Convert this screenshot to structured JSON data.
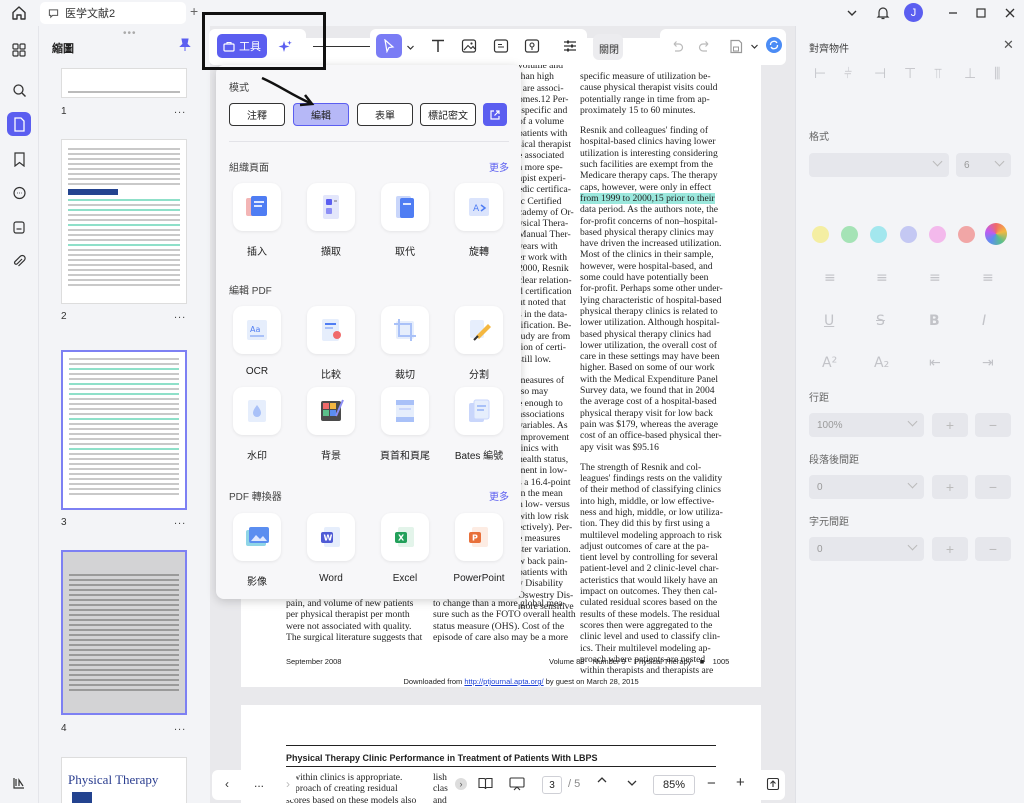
{
  "app": {
    "tab_title": "医学文献2",
    "avatar_initial": "J"
  },
  "thumbnails": {
    "title": "縮圖",
    "pages": [
      {
        "number": "1",
        "more": "..."
      },
      {
        "number": "2",
        "more": "..."
      },
      {
        "number": "3",
        "more": "..."
      },
      {
        "number": "4",
        "more": "..."
      }
    ],
    "page5_heading_1": "Physical",
    "page5_heading_2": "Therapy"
  },
  "toolbar": {
    "tools_label": "工具",
    "close_label": "關閉"
  },
  "tools_panel": {
    "mode_title": "模式",
    "modes": [
      {
        "label": "注釋"
      },
      {
        "label": "編輯"
      },
      {
        "label": "表單"
      },
      {
        "label": "標記密文"
      }
    ],
    "organize_title": "組織頁面",
    "organize_more": "更多",
    "organize_items": [
      {
        "label": "插入",
        "icon": "insert-pages-icon"
      },
      {
        "label": "擷取",
        "icon": "extract-pages-icon"
      },
      {
        "label": "取代",
        "icon": "replace-pages-icon"
      },
      {
        "label": "旋轉",
        "icon": "rotate-pages-icon"
      }
    ],
    "edit_title": "編輯 PDF",
    "edit_items": [
      {
        "label": "OCR",
        "icon": "ocr-icon"
      },
      {
        "label": "比較",
        "icon": "compare-icon"
      },
      {
        "label": "裁切",
        "icon": "crop-icon"
      },
      {
        "label": "分割",
        "icon": "split-icon"
      },
      {
        "label": "水印",
        "icon": "watermark-icon"
      },
      {
        "label": "背景",
        "icon": "background-icon"
      },
      {
        "label": "頁首和頁尾",
        "icon": "header-footer-icon"
      },
      {
        "label": "Bates 編號",
        "icon": "bates-number-icon"
      }
    ],
    "convert_title": "PDF 轉換器",
    "convert_more": "更多",
    "convert_items": [
      {
        "label": "影像",
        "icon": "image-icon"
      },
      {
        "label": "Word",
        "icon": "word-icon"
      },
      {
        "label": "Excel",
        "icon": "excel-icon"
      },
      {
        "label": "PowerPoint",
        "icon": "powerpoint-icon"
      }
    ]
  },
  "document": {
    "col_left_peek": [
      "volume and",
      "than high",
      ", are associ-",
      "omes.12 Per-",
      "-specific and",
      "of a volume",
      "patients with",
      "sical therapist",
      "e associated",
      "a more spe-",
      "apist experi-",
      "edic certifica-",
      "ic Certified",
      "cademy of Or-",
      "ysical Thera-",
      "Manual Ther-",
      "years with",
      "er work with",
      "2000, Resnik",
      "clear relation-",
      "d certification",
      "ut noted that",
      "s in the data-",
      "tification. Be-",
      "tudy are from",
      "tion of certi-",
      "still low."
    ],
    "col_left_peek_2": [
      "measures of",
      "lso may",
      "e enough to",
      "associations",
      "variables. As",
      "improvement",
      "linics with",
      "health status,",
      "ment in low-",
      "s a 16.4-point",
      "in the mean",
      "n low- versus",
      "with low risk",
      "ectively). Per-",
      "e measures",
      "ster variation.",
      "w back pain-",
      "patients with",
      "y Disability",
      "Oswestry Dis-",
      "more sensitive"
    ],
    "right_para_1": [
      "specific measure of utilization be-",
      "cause physical therapist visits could",
      "potentially range in time from ap-",
      "proximately 15 to 60 minutes."
    ],
    "right_para_2": [
      "Resnik and colleagues' finding of",
      "hospital-based clinics having lower",
      "utilization is interesting considering",
      "such facilities are exempt from the",
      "Medicare therapy caps. The therapy",
      "caps, however, were only in effect",
      "from 1999 to 2000,15 prior to their",
      "data period. As the authors note, the",
      "for-profit concerns of non–hospital-",
      "based physical therapy clinics may",
      "have driven the increased utilization.",
      "Most of the clinics in their sample,",
      "however, were hospital-based, and",
      "some could have potentially been",
      "for-profit. Perhaps some other under-",
      "lying characteristic of hospital-based",
      "physical therapy clinics is related to",
      "lower utilization. Although hospital-",
      "based physical therapy clinics had",
      "lower utilization, the overall cost of",
      "care in these settings may have been",
      "higher. Based on some of our work",
      "with the Medical Expenditure Panel",
      "Survey data, we found that in 2004",
      "the average cost of a hospital-based",
      "physical therapy visit for low back",
      "pain was $179, whereas the average",
      "cost of an office-based physical ther-",
      "apy visit was $95.16"
    ],
    "right_para_3": [
      "The strength of Resnik and col-",
      "leagues' findings rests on the validity",
      "of their method of classifying clinics",
      "into high, middle, or low effective-",
      "ness and high, middle, or low utiliza-",
      "tion. They did this by first using a",
      "multilevel modeling approach to risk",
      "adjust outcomes of care at the pa-",
      "tient level by controlling for several",
      "patient-level and 2 clinic-level char-",
      "acteristics that would likely have an",
      "impact on outcomes. They then cal-",
      "culated residual scores based on the",
      "results of these models. The residual",
      "scores then were aggregated to the",
      "clinic level and used to classify clin-",
      "ics. Their multilevel modeling ap-",
      "proach where patients are nested",
      "within therapists and therapists are"
    ],
    "bottom_col_a": [
      "pain, and volume of new patients",
      "per physical therapist per month",
      "were not associated with quality.",
      "The surgical literature suggests that"
    ],
    "bottom_col_b": [
      "to change than a more global mea-",
      "sure such as the FOTO overall health",
      "status measure (OHS). Cost of the",
      "episode of care also may be a more"
    ],
    "footer_left": "September 2008",
    "footer_right": "Volume 88    Number 9    Physical Therapy    ■    1005",
    "download_prefix": "Downloaded from ",
    "download_link": "http://ptjournal.apta.org/",
    "download_suffix": " by guest on March 28, 2015",
    "page2_title": "Physical Therapy Clinic Performance in Treatment of Patients With LBPS",
    "page2_lines_a": [
      "d within clinics is appropriate.",
      "approach of creating residual",
      "scores based on these models also"
    ],
    "page2_lines_b": [
      "lish",
      "clas",
      "and"
    ]
  },
  "properties": {
    "title": "對齊物件",
    "format_label": "格式",
    "font_size": "6",
    "line_spacing_label": "行距",
    "line_spacing_value": "100%",
    "para_spacing_label": "段落後間距",
    "para_spacing_value": "0",
    "char_spacing_label": "字元間距",
    "char_spacing_value": "0",
    "swatches": [
      "#f4eea2",
      "#a5e3b6",
      "#a3e7ee",
      "#c4c8f3",
      "#f3b9ec",
      "#f1a6a6"
    ]
  },
  "navigation": {
    "more": "...",
    "current_page": "3",
    "total_pages": "/ 5",
    "zoom": "85%"
  }
}
